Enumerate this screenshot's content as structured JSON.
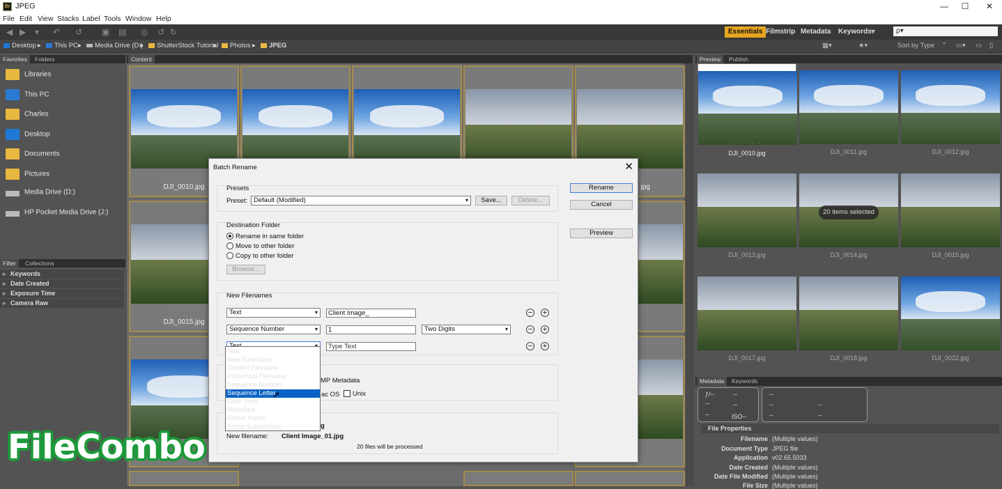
{
  "window": {
    "app_badge": "Br",
    "title": "JPEG",
    "minimize": "—",
    "maximize": "☐",
    "close": "✕"
  },
  "menu": [
    "File",
    "Edit",
    "View",
    "Stacks",
    "Label",
    "Tools",
    "Window",
    "Help"
  ],
  "workspaces": {
    "active": "Essentials",
    "items": [
      "Filmstrip",
      "Metadata",
      "Keywords"
    ]
  },
  "search": {
    "placeholder": "ρ▾"
  },
  "path": [
    "Desktop",
    "This PC",
    "Media Drive (D:)",
    "ShutterStock Tutorial",
    "Photos",
    "JPEG"
  ],
  "sort": {
    "label": "Sort by Type"
  },
  "left_tabs": {
    "favorites": "Favorites",
    "folders": "Folders"
  },
  "favorites": [
    "Libraries",
    "This PC",
    "Charles",
    "Desktop",
    "Documents",
    "Pictures",
    "Media Drive (D:)",
    "HP Pocket Media Drive (J:)"
  ],
  "filter_tabs": {
    "filter": "Filter",
    "collections": "Collections"
  },
  "filters": [
    "Keywords",
    "Date Created",
    "Exposure Time",
    "Camera Raw"
  ],
  "content_tab": "Content",
  "content_captions": {
    "c1": "DJI_0010.jpg",
    "c2": "jpg",
    "c3": "DJI_0015.jpg"
  },
  "preview_tabs": {
    "preview": "Preview",
    "publish": "Publish"
  },
  "preview_thumbs": [
    "DJI_0010.jpg",
    "DJI_0011.jpg",
    "DJI_0012.jpg",
    "DJI_0013.jpg",
    "DJI_0014.jpg",
    "DJI_0015.jpg",
    "DJI_0017.jpg",
    "DJI_0018.jpg",
    "DJI_0022.jpg"
  ],
  "selection_badge": "20 items selected",
  "meta_tabs": {
    "metadata": "Metadata",
    "keywords": "Keywords"
  },
  "meta_box": {
    "f": "ƒ/--",
    "a": "--",
    "b": "--",
    "c": "--",
    "d": "--",
    "iso": "ISO--",
    "r1": "--",
    "r2": "--",
    "r3": "--",
    "r4": "--",
    "r5": "--"
  },
  "file_properties": {
    "header": "File Properties",
    "rows": [
      {
        "k": "Filename",
        "v": "(Multiple values)"
      },
      {
        "k": "Document Type",
        "v": "JPEG file"
      },
      {
        "k": "Application",
        "v": "v02.65.5033"
      },
      {
        "k": "Date Created",
        "v": "(Multiple values)"
      },
      {
        "k": "Date File Modified",
        "v": "(Multiple values)"
      },
      {
        "k": "File Size",
        "v": "(Multiple values)"
      }
    ]
  },
  "dialog": {
    "title": "Batch Rename",
    "close": "✕",
    "presets_label": "Presets",
    "preset_label": "Preset:",
    "preset_value": "Default (Modified)",
    "save": "Save...",
    "delete": "Delete...",
    "rename": "Rename",
    "cancel": "Cancel",
    "preview": "Preview",
    "dest_label": "Destination Folder",
    "dest_options": [
      "Rename in same folder",
      "Move to other folder",
      "Copy to other folder"
    ],
    "browse": "Browse...",
    "newfn_label": "New Filenames",
    "row1": {
      "type": "Text",
      "value": "Client Image_"
    },
    "row2": {
      "type": "Sequence Number",
      "value": "1",
      "digits": "Two Digits"
    },
    "row3": {
      "type": "Text",
      "placeholder": "Type Text"
    },
    "dropdown": [
      "Text",
      "New Extension",
      "Current Filename",
      "Preserved Filename",
      "Sequence Number",
      "Sequence Letter",
      "Date Time",
      "Metadata",
      "Folder Name",
      "String Substitution"
    ],
    "dropdown_highlight": "Sequence Letter",
    "xmp_fragment": "MP Metadata",
    "mac_fragment": "ac OS",
    "unix": "Unix",
    "current_fragment": "g",
    "new_filename_label": "New filename:",
    "new_filename_value": "Client Image_01.jpg",
    "processed": "20 files will be processed"
  },
  "watermark": "FileCombo"
}
